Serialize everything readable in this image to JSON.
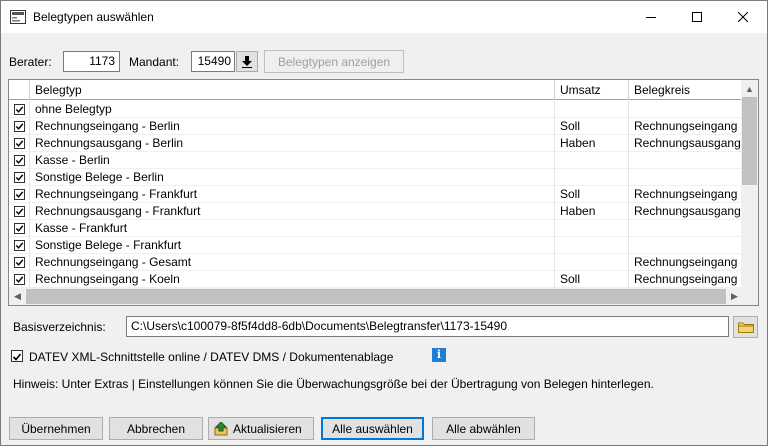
{
  "window": {
    "title": "Belegtypen auswählen",
    "icon": "app-dialog-icon"
  },
  "filters": {
    "berater_label": "Berater:",
    "berater_value": "1173",
    "mandant_label": "Mandant:",
    "mandant_value": "15490",
    "show_button": "Belegtypen anzeigen"
  },
  "table": {
    "columns": [
      "Belegtyp",
      "Umsatz",
      "Belegkreis"
    ],
    "rows": [
      {
        "checked": true,
        "belegtyp": "ohne Belegtyp",
        "umsatz": "",
        "belegkreis": ""
      },
      {
        "checked": true,
        "belegtyp": "Rechnungseingang - Berlin",
        "umsatz": "Soll",
        "belegkreis": "Rechnungseingang"
      },
      {
        "checked": true,
        "belegtyp": "Rechnungsausgang - Berlin",
        "umsatz": "Haben",
        "belegkreis": "Rechnungsausgang"
      },
      {
        "checked": true,
        "belegtyp": "Kasse - Berlin",
        "umsatz": "",
        "belegkreis": ""
      },
      {
        "checked": true,
        "belegtyp": "Sonstige Belege - Berlin",
        "umsatz": "",
        "belegkreis": ""
      },
      {
        "checked": true,
        "belegtyp": "Rechnungseingang - Frankfurt",
        "umsatz": "Soll",
        "belegkreis": "Rechnungseingang"
      },
      {
        "checked": true,
        "belegtyp": "Rechnungsausgang - Frankfurt",
        "umsatz": "Haben",
        "belegkreis": "Rechnungsausgang"
      },
      {
        "checked": true,
        "belegtyp": "Kasse - Frankfurt",
        "umsatz": "",
        "belegkreis": ""
      },
      {
        "checked": true,
        "belegtyp": "Sonstige Belege - Frankfurt",
        "umsatz": "",
        "belegkreis": ""
      },
      {
        "checked": true,
        "belegtyp": "Rechnungseingang - Gesamt",
        "umsatz": "",
        "belegkreis": "Rechnungseingang"
      },
      {
        "checked": true,
        "belegtyp": "Rechnungseingang - Koeln",
        "umsatz": "Soll",
        "belegkreis": "Rechnungseingang"
      }
    ]
  },
  "basis": {
    "label": "Basisverzeichnis:",
    "path": "C:\\Users\\c100079-8f5f4dd8-6db\\Documents\\Belegtransfer\\1173-15490"
  },
  "option": {
    "checked": true,
    "label": "DATEV XML-Schnittstelle online / DATEV DMS / Dokumentenablage"
  },
  "hint": "Hinweis: Unter Extras | Einstellungen können Sie die Überwachungsgröße bei der Übertragung von Belegen hinterlegen.",
  "buttons": {
    "apply": "Übernehmen",
    "cancel": "Abbrechen",
    "refresh": "Aktualisieren",
    "select_all": "Alle auswählen",
    "deselect_all": "Alle abwählen"
  },
  "colors": {
    "accent": "#0078d7",
    "info": "#1e7fd6"
  }
}
